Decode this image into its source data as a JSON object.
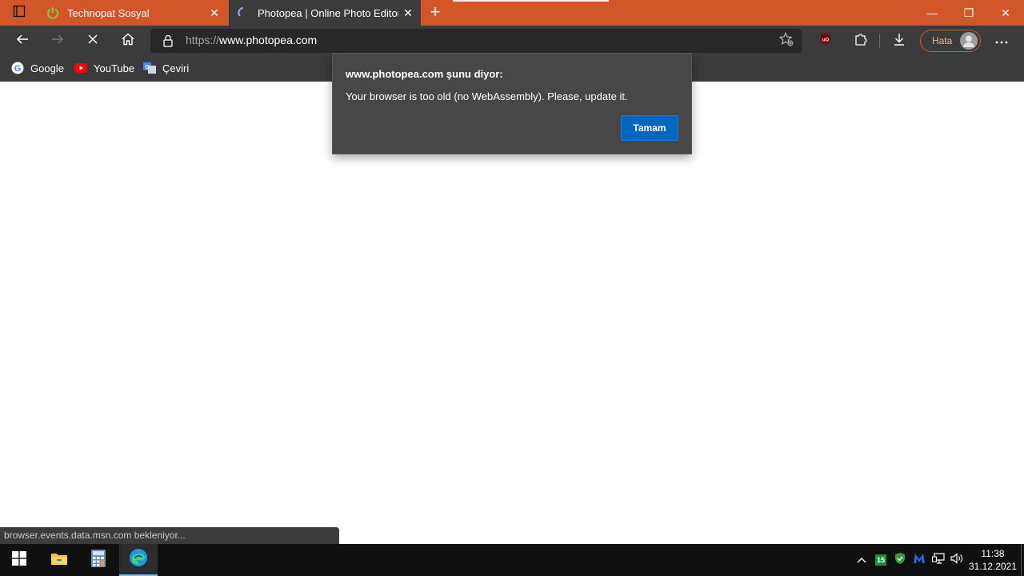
{
  "browser": {
    "tabs": [
      {
        "title": "Technopat Sosyal",
        "icon": "power-icon",
        "active": false
      },
      {
        "title": "Photopea | Online Photo Editor",
        "icon": "loading-spinner-icon",
        "active": true
      }
    ],
    "new_tab_label": "+",
    "window_controls": {
      "minimize": "—",
      "maximize": "❐",
      "close": "✕"
    },
    "address": {
      "protocol": "https://",
      "host": "www.photopea.com"
    },
    "profile_label": "Hata",
    "accent_color": "#d1562a",
    "favorites": [
      {
        "label": "Google",
        "icon": "google-icon"
      },
      {
        "label": "YouTube",
        "icon": "youtube-icon"
      },
      {
        "label": "Çeviri",
        "icon": "translate-icon"
      }
    ]
  },
  "dialog": {
    "title": "www.photopea.com şunu diyor:",
    "message": "Your browser is too old (no WebAssembly). Please, update it.",
    "ok_label": "Tamam"
  },
  "status_text": "browser.events.data.msn.com bekleniyor...",
  "taskbar": {
    "apps": [
      "start-icon",
      "file-explorer-icon",
      "calculator-icon",
      "edge-icon"
    ],
    "tray_badge": "15",
    "time": "11:38",
    "date": "31.12.2021"
  }
}
